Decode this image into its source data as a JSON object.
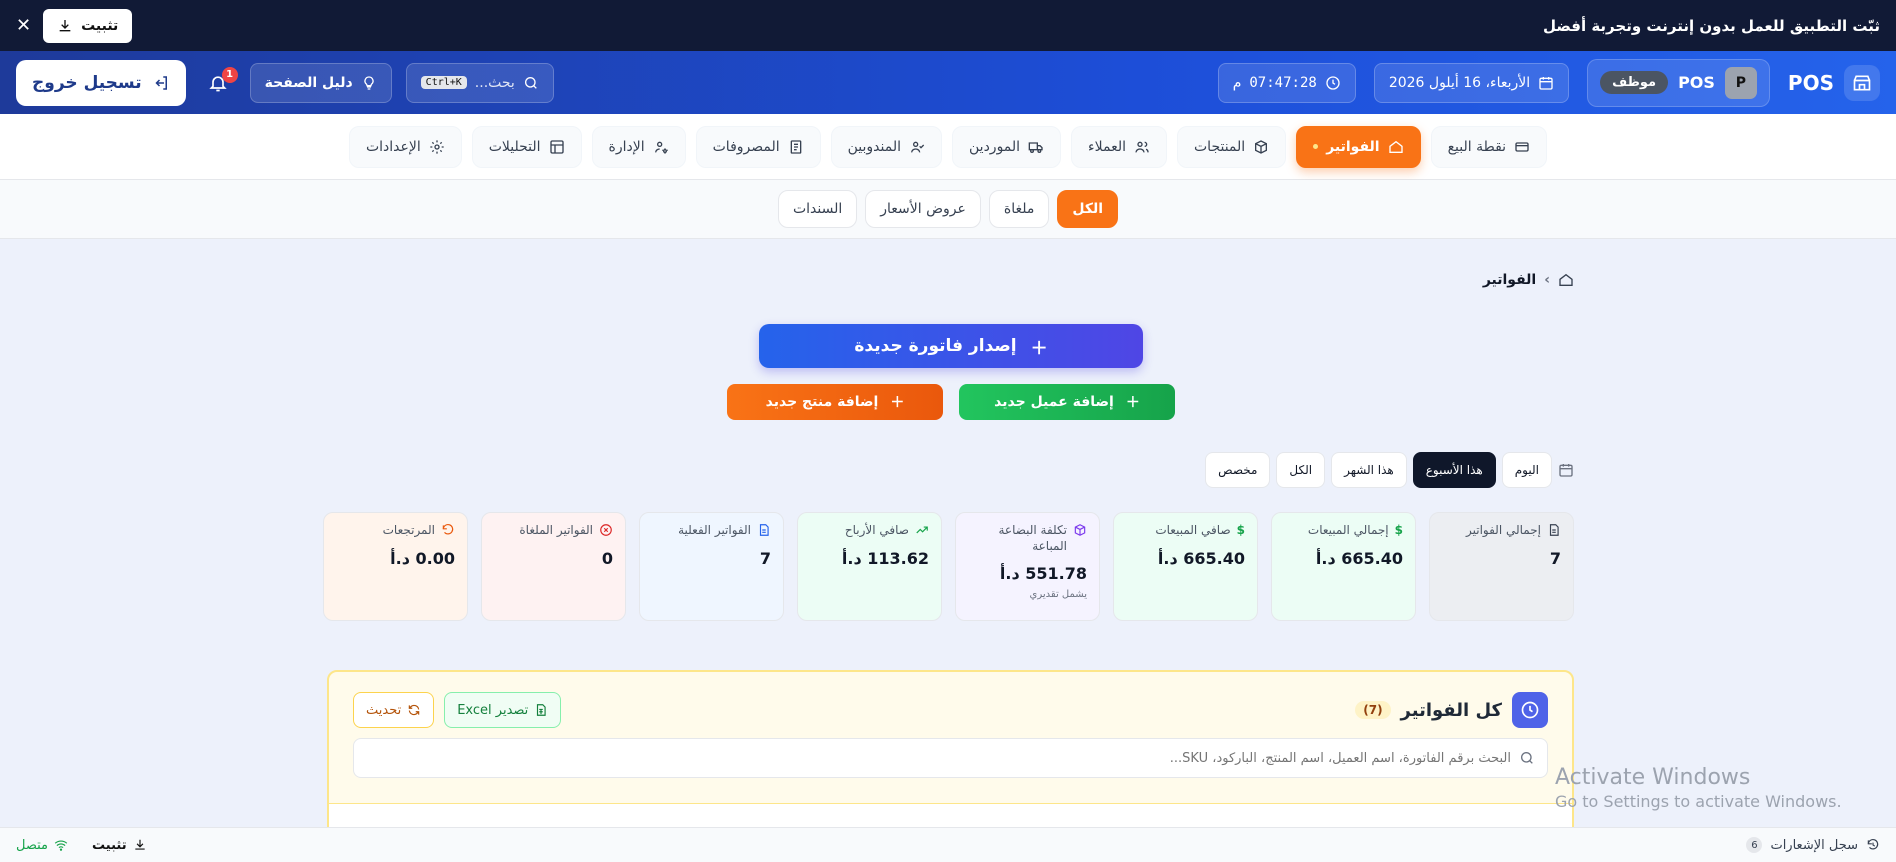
{
  "install_banner": {
    "message": "ثبّت التطبيق للعمل بدون إنترنت وتجربة أفضل",
    "install_label": "تثبيت"
  },
  "header": {
    "brand": "POS",
    "user_initial": "P",
    "user_name": "POS",
    "role": "موظف",
    "date": "الأربعاء، 16 أيلول 2026",
    "time": "07:47:28",
    "time_suffix": "م",
    "search_placeholder": "بحث...",
    "search_shortcut": "Ctrl+K",
    "guide_label": "دليل الصفحة",
    "notifications_count": "1",
    "logout_label": "تسجيل خروج"
  },
  "nav": {
    "pos": "نقطة البيع",
    "invoices": "الفواتير",
    "products": "المنتجات",
    "clients": "العملاء",
    "suppliers": "الموردين",
    "reps": "المندوبين",
    "expenses": "المصروفات",
    "admin": "الإدارة",
    "analytics": "التحليلات",
    "settings": "الإعدادات"
  },
  "sub_tabs": {
    "all": "الكل",
    "cancelled": "ملغاة",
    "quotes": "عروض الأسعار",
    "vouchers": "السندات"
  },
  "breadcrumb": {
    "current": "الفواتير"
  },
  "actions": {
    "new_invoice": "إصدار فاتورة جديدة",
    "add_client": "إضافة عميل جديد",
    "add_product": "إضافة منتج جديد"
  },
  "period": {
    "today": "اليوم",
    "week": "هذا الأسبوع",
    "month": "هذا الشهر",
    "all": "الكل",
    "custom": "مخصص"
  },
  "stats": {
    "total_invoices": {
      "label": "إجمالي الفواتير",
      "value": "7"
    },
    "total_sales": {
      "label": "إجمالي المبيعات",
      "value": "665.40 د.أ"
    },
    "net_sales": {
      "label": "صافي المبيعات",
      "value": "665.40 د.أ"
    },
    "cogs": {
      "label": "تكلفة البضاعة المباعة",
      "value": "551.78 د.أ",
      "note": "يشمل تقديري"
    },
    "net_profit": {
      "label": "صافي الأرباح",
      "value": "113.62 د.أ"
    },
    "actual_invoices": {
      "label": "الفواتير الفعلية",
      "value": "7"
    },
    "cancelled_invoices": {
      "label": "الفواتير الملغاة",
      "value": "0"
    },
    "returns": {
      "label": "المرتجعات",
      "value": "0.00 د.أ"
    }
  },
  "panel": {
    "title": "كل الفواتير",
    "count": "(7)",
    "export_label": "تصدير Excel",
    "refresh_label": "تحديث",
    "search_placeholder": "البحث برقم الفاتورة، اسم العميل، اسم المنتج، الباركود، SKU..."
  },
  "watermark": {
    "line1": "Activate Windows",
    "line2": "Go to Settings to activate Windows."
  },
  "footer": {
    "log_label": "سجل الإشعارات",
    "log_count": "6",
    "install_label": "تثبيت",
    "status": "متصل"
  },
  "colors": {
    "header_bg": "#1d4ed8",
    "banner_bg": "#111a36",
    "accent_orange": "#f97316",
    "accent_green": "#16a34a",
    "accent_indigo": "#4f46e5"
  }
}
